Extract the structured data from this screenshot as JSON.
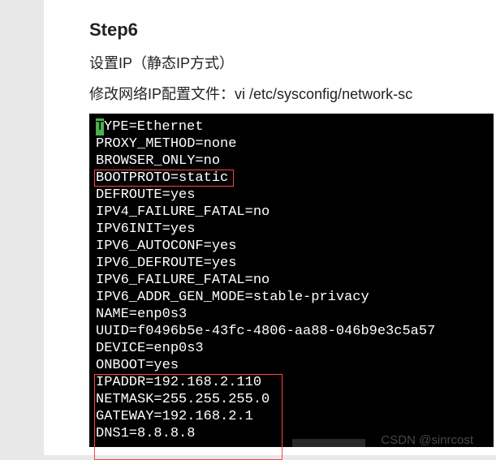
{
  "heading": "Step6",
  "desc1": "设置IP（静态IP方式）",
  "desc2_prefix": "修改网络IP配置文件：vi ",
  "desc2_path": "/etc/sysconfig/network-sc",
  "terminal": {
    "cursor_char": "T",
    "line1_rest": "YPE=Ethernet",
    "lines": [
      "PROXY_METHOD=none",
      "BROWSER_ONLY=no",
      "BOOTPROTO=static",
      "DEFROUTE=yes",
      "IPV4_FAILURE_FATAL=no",
      "IPV6INIT=yes",
      "IPV6_AUTOCONF=yes",
      "IPV6_DEFROUTE=yes",
      "IPV6_FAILURE_FATAL=no",
      "IPV6_ADDR_GEN_MODE=stable-privacy",
      "NAME=enp0s3",
      "UUID=f0496b5e-43fc-4806-aa88-046b9e3c5a57",
      "DEVICE=enp0s3",
      "ONBOOT=yes",
      "IPADDR=192.168.2.110",
      "NETMASK=255.255.255.0",
      "GATEWAY=192.168.2.1",
      "DNS1=8.8.8.8"
    ]
  },
  "watermark": "CSDN @sinrcost"
}
